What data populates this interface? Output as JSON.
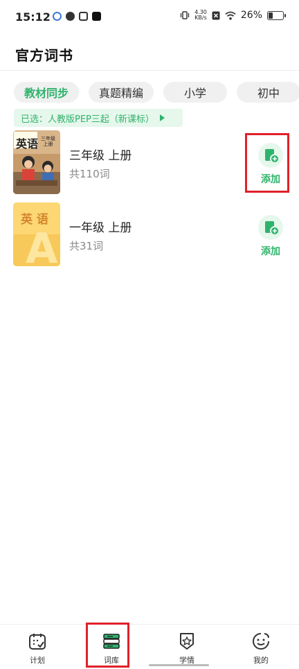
{
  "status_bar": {
    "time": "15:12",
    "net_speed_value": "4.30",
    "net_speed_unit": "KB/s",
    "battery": "26%",
    "battery_level": 0.26
  },
  "header": {
    "title": "官方词书"
  },
  "tabs": [
    {
      "label": "教材同步",
      "active": true
    },
    {
      "label": "真题精编",
      "active": false
    },
    {
      "label": "小学",
      "active": false
    },
    {
      "label": "初中",
      "active": false
    }
  ],
  "selected": {
    "text": "已选：人教版PEP三起（新课标）"
  },
  "books": [
    {
      "name": "三年级 上册",
      "count": "共110词",
      "add_label": "添加",
      "cover_title": "英语",
      "cover_subtitle_1": "三年级",
      "cover_subtitle_2": "上册"
    },
    {
      "name": "一年级 上册",
      "count": "共31词",
      "add_label": "添加",
      "cover_title": "英 语",
      "cover_letter": "A"
    }
  ],
  "bottom_nav": [
    {
      "label": "计划",
      "icon": "calendar-check-icon"
    },
    {
      "label": "词库",
      "icon": "books-icon"
    },
    {
      "label": "学情",
      "icon": "star-badge-icon"
    },
    {
      "label": "我的",
      "icon": "smiley-icon"
    }
  ],
  "colors": {
    "accent": "#2fb36c",
    "accent_light": "#e6f7ec",
    "highlight": "#e0202a"
  }
}
